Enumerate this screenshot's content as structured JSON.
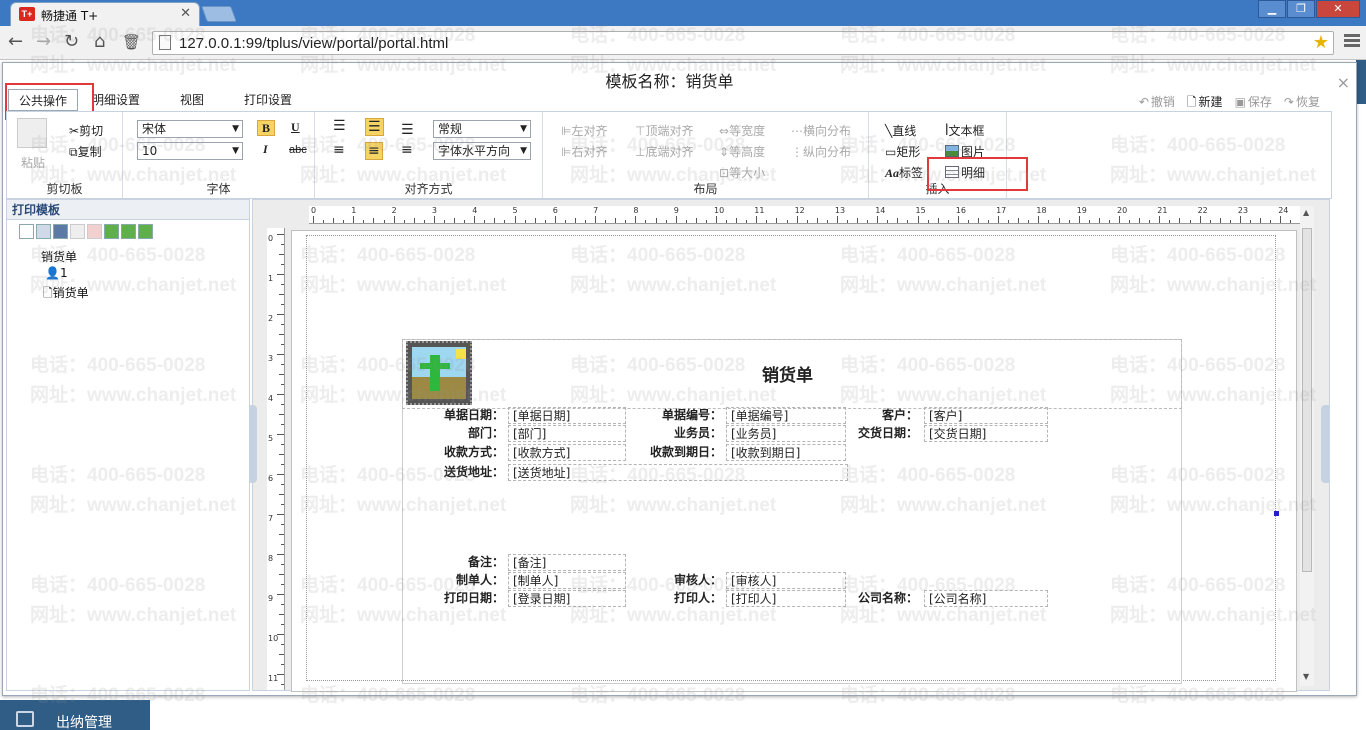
{
  "browser": {
    "tab_title": "畅捷通 T+",
    "favicon": "T+",
    "url": "127.0.0.1:99/tplus/view/portal/portal.html",
    "icons": [
      "back-icon",
      "forward-icon",
      "reload-icon",
      "home-icon",
      "trash-icon",
      "page-icon",
      "star-icon",
      "menu-icon"
    ]
  },
  "dialog": {
    "title": "模板名称：销货单",
    "close": "×"
  },
  "tabs": [
    "公共操作",
    "明细设置",
    "视图",
    "打印设置"
  ],
  "quick_actions": [
    {
      "label": "撤销",
      "icon": "undo-icon",
      "enabled": false
    },
    {
      "label": "新建",
      "icon": "new-icon",
      "enabled": true
    },
    {
      "label": "保存",
      "icon": "save-icon",
      "enabled": false
    },
    {
      "label": "恢复",
      "icon": "restore-icon",
      "enabled": false
    }
  ],
  "ribbon": {
    "clipboard": {
      "paste": "粘贴",
      "cut": "剪切",
      "copy": "复制",
      "label": "剪切板"
    },
    "font": {
      "family": "宋体",
      "size": "10",
      "label": "字体"
    },
    "align": {
      "style": "常规",
      "mode": "字体水平方向",
      "label": "对齐方式"
    },
    "layout": {
      "left_align": "左对齐",
      "right_align": "右对齐",
      "top_align": "顶端对齐",
      "bottom_align": "底端对齐",
      "same_width": "等宽度",
      "same_height": "等高度",
      "same_size": "等大小",
      "h_distribute": "横向分布",
      "v_distribute": "纵向分布",
      "label": "布局"
    },
    "insert": {
      "line": "直线",
      "rect": "矩形",
      "label_item": "标签",
      "textbox": "文本框",
      "image": "图片",
      "detail": "明细",
      "label": "插入"
    }
  },
  "left_panel": {
    "title": "打印模板",
    "tree": {
      "root": "销货单",
      "user": "1",
      "child": "销货单"
    }
  },
  "ruler": {
    "h": [
      "0",
      "1",
      "2",
      "3",
      "4",
      "5",
      "6",
      "7",
      "8",
      "9",
      "10",
      "11",
      "12",
      "13",
      "14",
      "15",
      "16",
      "17",
      "18",
      "19",
      "20",
      "21",
      "22",
      "23",
      "24"
    ],
    "v": [
      "0",
      "1",
      "2",
      "3",
      "4",
      "5",
      "6",
      "7",
      "8",
      "9",
      "10",
      "11"
    ]
  },
  "report": {
    "title": "销货单",
    "rows": [
      {
        "l1": "单据日期：",
        "f1": "[单据日期]",
        "l2": "单据编号：",
        "f2": "[单据编号]",
        "l3": "客户：",
        "f3": "[客户]"
      },
      {
        "l1": "部门：",
        "f1": "[部门]",
        "l2": "业务员：",
        "f2": "[业务员]",
        "l3": "交货日期：",
        "f3": "[交货日期]"
      },
      {
        "l1": "收款方式：",
        "f1": "[收款方式]",
        "l2": "收款到期日：",
        "f2": "[收款到期日]"
      },
      {
        "l1": "送货地址：",
        "f1": "[送货地址]"
      }
    ],
    "footer": [
      {
        "l1": "备注：",
        "f1": "[备注]"
      },
      {
        "l1": "制单人：",
        "f1": "[制单人]",
        "l2": "审核人：",
        "f2": "[审核人]"
      },
      {
        "l1": "打印日期：",
        "f1": "[登录日期]",
        "l2": "打印人：",
        "f2": "[打印人]",
        "l3": "公司名称：",
        "f3": "[公司名称]"
      }
    ]
  },
  "background": {
    "menu_item": "出纳管理"
  },
  "watermark": {
    "phone": "电话：400-665-0028",
    "site": "网址：www.chanjet.net"
  }
}
